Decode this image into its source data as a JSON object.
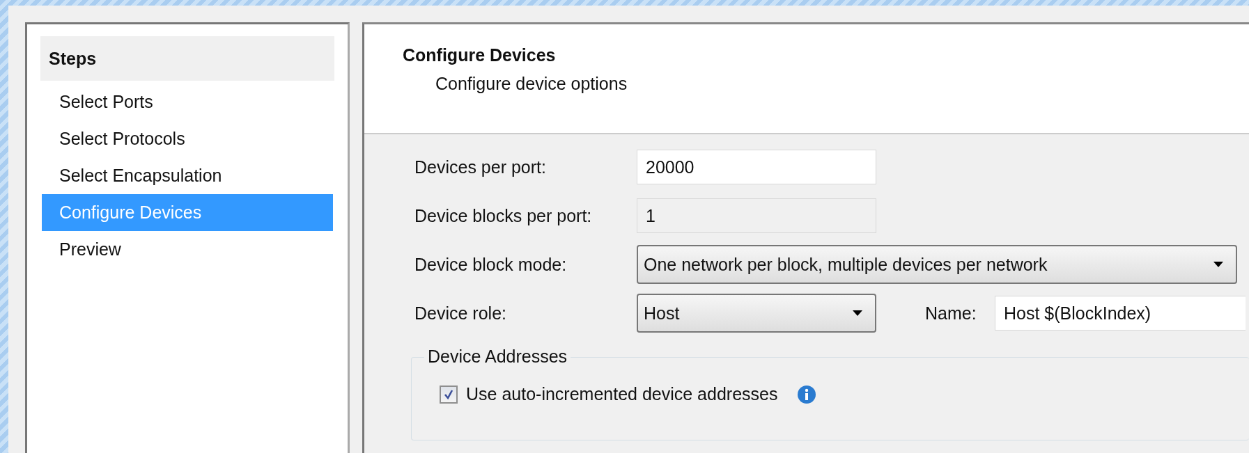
{
  "steps": {
    "title": "Steps",
    "items": [
      {
        "label": "Select Ports",
        "selected": false
      },
      {
        "label": "Select Protocols",
        "selected": false
      },
      {
        "label": "Select Encapsulation",
        "selected": false
      },
      {
        "label": "Configure Devices",
        "selected": true
      },
      {
        "label": "Preview",
        "selected": false
      }
    ]
  },
  "header": {
    "title": "Configure Devices",
    "subtitle": "Configure device options"
  },
  "fields": [
    {
      "kind": "input",
      "label": "Devices per port:",
      "value": "20000",
      "disabled": false
    },
    {
      "kind": "input",
      "label": "Device blocks per port:",
      "value": "1",
      "disabled": true
    },
    {
      "kind": "dropdown",
      "label": "Device block mode:",
      "value": "One network per block, multiple devices per network",
      "wide": true
    },
    {
      "kind": "dropdown",
      "label": "Device role:",
      "value": "Host",
      "wide": false,
      "extra": {
        "label": "Name:",
        "value": "Host $(BlockIndex)"
      }
    }
  ],
  "device_addresses": {
    "title": "Device Addresses",
    "checkbox": {
      "label": "Use auto-incremented device addresses",
      "checked": true
    }
  }
}
